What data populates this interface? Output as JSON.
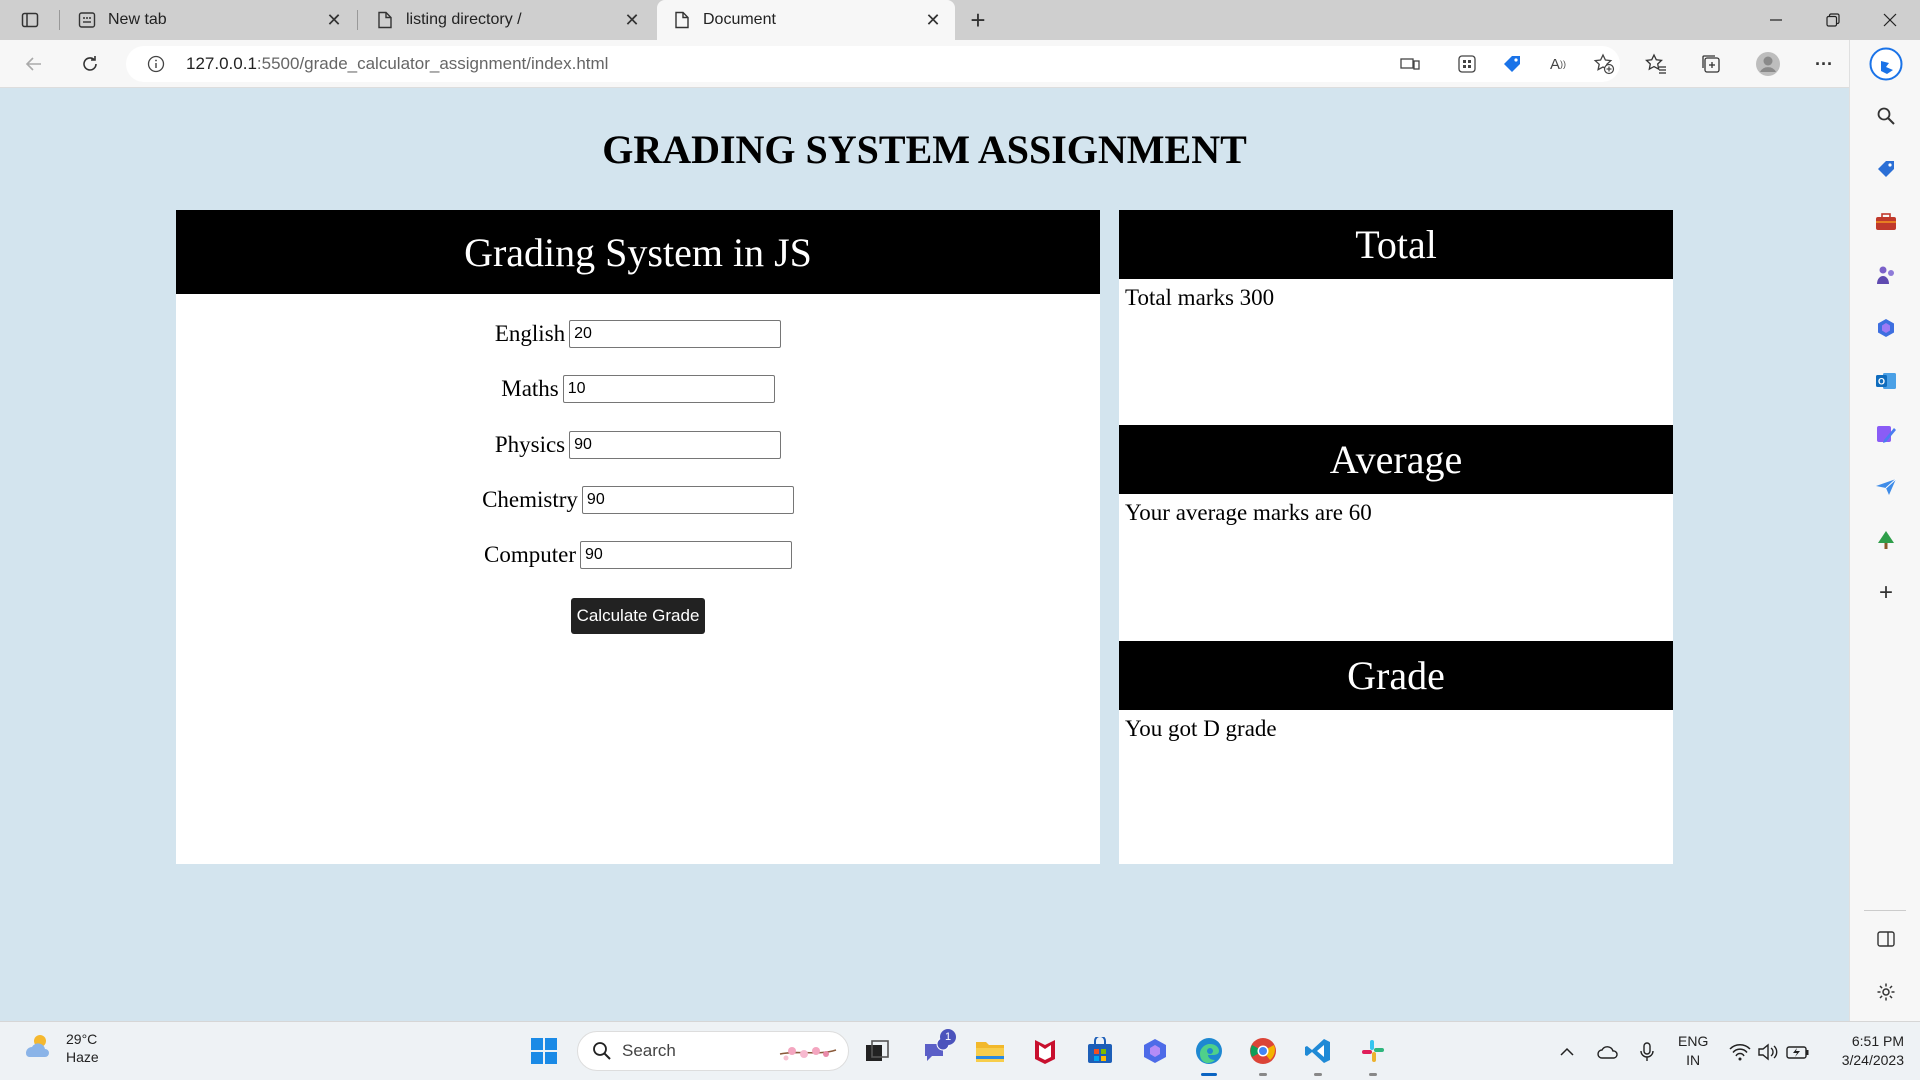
{
  "browser": {
    "tabs": [
      {
        "label": "New tab",
        "icon": "new-tab-page-icon",
        "active": false
      },
      {
        "label": "listing directory /",
        "icon": "document-icon",
        "active": false
      },
      {
        "label": "Document",
        "icon": "document-icon",
        "active": true
      }
    ],
    "new_tab_symbol": "+",
    "address": {
      "host": "127.0.0.1",
      "rest": ":5500/grade_calculator_assignment/index.html"
    }
  },
  "page": {
    "heading": "GRADING SYSTEM ASSIGNMENT",
    "calculator": {
      "title": "Grading System in JS",
      "fields": [
        {
          "label": "English",
          "value": "20"
        },
        {
          "label": "Maths",
          "value": "10"
        },
        {
          "label": "Physics",
          "value": "90"
        },
        {
          "label": "Chemistry",
          "value": "90"
        },
        {
          "label": "Computer",
          "value": "90"
        }
      ],
      "button_label": "Calculate Grade"
    },
    "results": {
      "total": {
        "title": "Total",
        "text": "Total marks 300"
      },
      "average": {
        "title": "Average",
        "text": "Your average marks are 60"
      },
      "grade": {
        "title": "Grade",
        "text": "You got D grade"
      }
    }
  },
  "taskbar": {
    "weather": {
      "temp": "29°C",
      "condition": "Haze"
    },
    "search_label": "Search",
    "teams_badge": "1",
    "language": {
      "line1": "ENG",
      "line2": "IN"
    },
    "clock": {
      "time": "6:51 PM",
      "date": "3/24/2023"
    }
  }
}
